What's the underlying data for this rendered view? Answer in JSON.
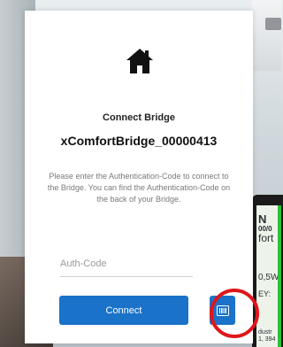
{
  "dialog": {
    "title": "Connect Bridge",
    "bridge_id": "xComfortBridge_00000413",
    "description": "Please enter the Authentication-Code to connect to the Bridge. You can find the Authentication-Code on the back of your Bridge.",
    "auth_input": {
      "placeholder": "Auth-Code",
      "value": ""
    },
    "connect_label": "Connect",
    "icons": {
      "header": "home-icon",
      "scan": "barcode-scan-icon"
    }
  },
  "background_label": {
    "line1": "N",
    "line2": "00/0",
    "line3": "fort",
    "line4": "0,5W",
    "line5": "EY:",
    "line6": "dustr",
    "line7": "1, 394"
  },
  "colors": {
    "accent": "#1a72c9",
    "highlight": "#e0161b"
  }
}
